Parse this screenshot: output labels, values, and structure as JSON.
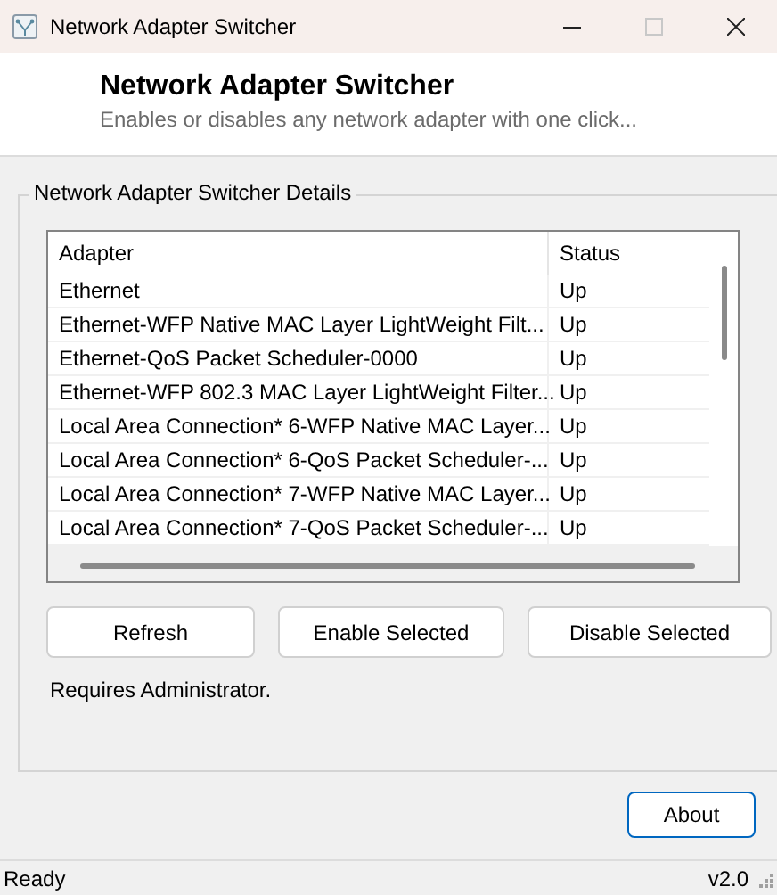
{
  "window": {
    "title": "Network Adapter Switcher",
    "controls": [
      {
        "kind": "minimize",
        "disabled": false
      },
      {
        "kind": "maximize",
        "disabled": true
      },
      {
        "kind": "close",
        "disabled": false
      }
    ]
  },
  "header": {
    "title": "Network Adapter Switcher",
    "subtitle": "Enables or disables any network adapter with one click..."
  },
  "details": {
    "title": "Network Adapter Switcher Details",
    "table": {
      "columns": [
        "Adapter",
        "Status"
      ],
      "rows": [
        {
          "adapter": "Ethernet",
          "status": "Up"
        },
        {
          "adapter": "Ethernet-WFP Native MAC Layer LightWeight Filt...",
          "status": "Up"
        },
        {
          "adapter": "Ethernet-QoS Packet Scheduler-0000",
          "status": "Up"
        },
        {
          "adapter": "Ethernet-WFP 802.3 MAC Layer LightWeight Filter...",
          "status": "Up"
        },
        {
          "adapter": "Local Area Connection* 6-WFP Native MAC Layer...",
          "status": "Up"
        },
        {
          "adapter": "Local Area Connection* 6-QoS Packet Scheduler-...",
          "status": "Up"
        },
        {
          "adapter": "Local Area Connection* 7-WFP Native MAC Layer...",
          "status": "Up"
        },
        {
          "adapter": "Local Area Connection* 7-QoS Packet Scheduler-...",
          "status": "Up"
        }
      ]
    },
    "buttons": [
      {
        "label": "Refresh",
        "focused": false
      },
      {
        "label": "Enable Selected",
        "focused": false
      },
      {
        "label": "Disable Selected",
        "focused": false
      }
    ],
    "note": "Requires Administrator."
  },
  "about_button": {
    "label": "About",
    "focused": true
  },
  "status_bar": {
    "text": "Ready",
    "version": "v2.0"
  }
}
